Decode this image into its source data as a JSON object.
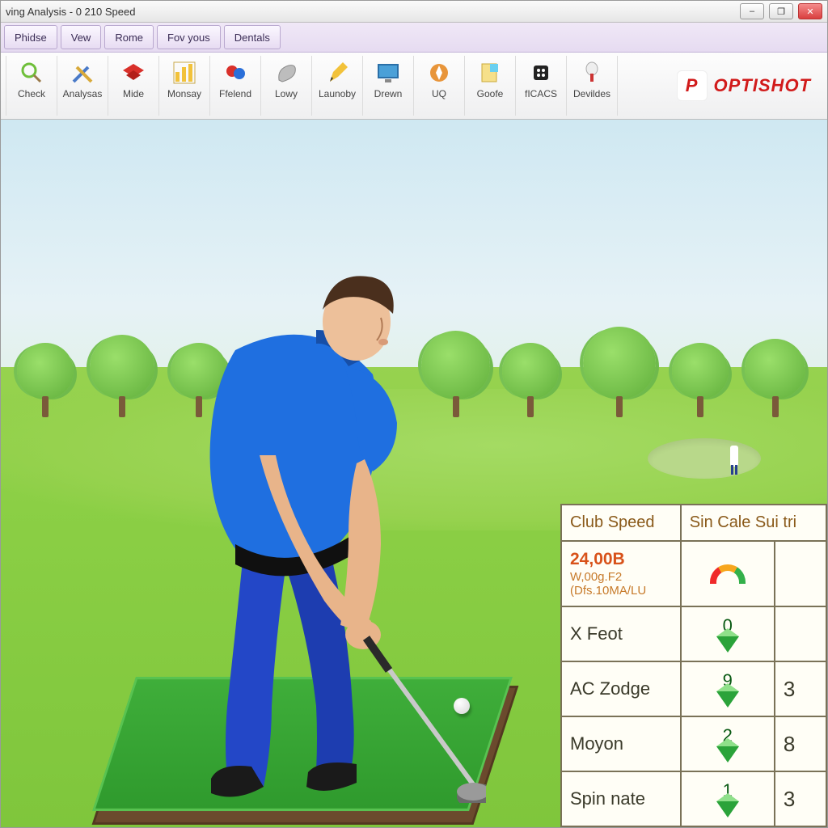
{
  "window": {
    "title": "ving Analysis - 0 210 Speed",
    "buttons": {
      "min": "–",
      "max": "❐",
      "close": "✕"
    }
  },
  "menubar": [
    {
      "label": "Phidse"
    },
    {
      "label": "Vew"
    },
    {
      "label": "Rome"
    },
    {
      "label": "Fov yous"
    },
    {
      "label": "Dentals"
    }
  ],
  "toolbar": [
    {
      "label": "Check",
      "icon": "magnifier-icon"
    },
    {
      "label": "Analysas",
      "icon": "tools-icon"
    },
    {
      "label": "Mide",
      "icon": "red-flag-icon"
    },
    {
      "label": "Monsay",
      "icon": "chart-icon"
    },
    {
      "label": "Ffelend",
      "icon": "palette-icon"
    },
    {
      "label": "Lowy",
      "icon": "club-icon"
    },
    {
      "label": "Launoby",
      "icon": "pencil-icon"
    },
    {
      "label": "Drewn",
      "icon": "monitor-icon"
    },
    {
      "label": "UQ",
      "icon": "compass-icon"
    },
    {
      "label": "Goofe",
      "icon": "note-icon"
    },
    {
      "label": "fICACS",
      "icon": "chip-icon"
    },
    {
      "label": "Devildes",
      "icon": "pin-icon"
    }
  ],
  "brand": {
    "name": "OPTISHOT",
    "mark": "P"
  },
  "scene": {
    "golfer_desc": "golfer addressing ball",
    "ball_desc": "golf ball on mat"
  },
  "stats": {
    "headers": [
      "Club Speed",
      "Sin Cale Sui tri"
    ],
    "speed": {
      "v1": "24,00B",
      "v2": "W,00g.F2",
      "v3": "(Dfs.10MA/LU"
    },
    "rows": [
      {
        "label": "X Feot",
        "tri": "0",
        "val": ""
      },
      {
        "label": "AC Zodge",
        "tri": "9",
        "val": "3"
      },
      {
        "label": "Moyon",
        "tri": "2",
        "val": "8"
      },
      {
        "label": "Spin nate",
        "tri": "1",
        "val": "3"
      }
    ]
  }
}
